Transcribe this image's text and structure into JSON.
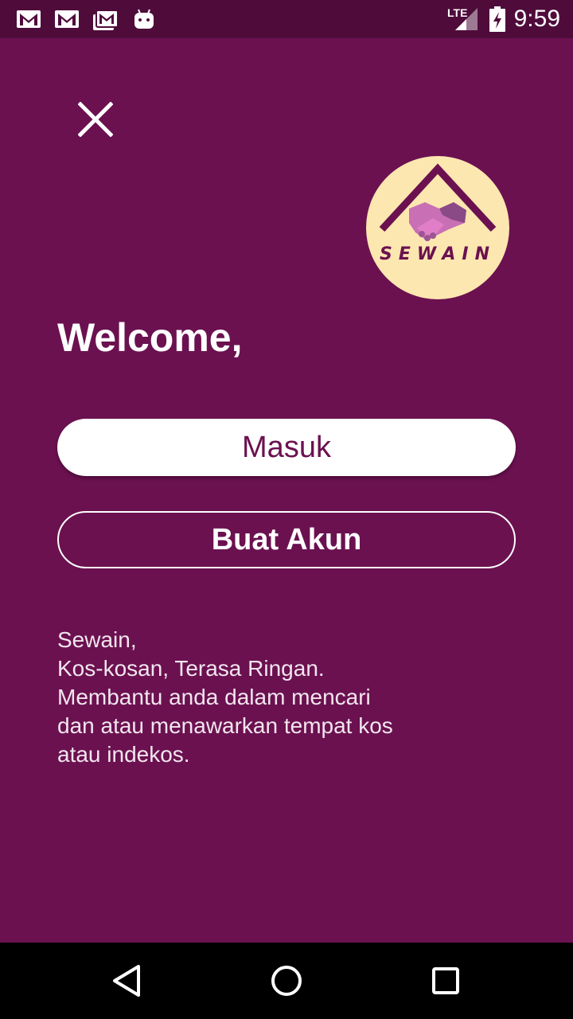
{
  "status_bar": {
    "time": "9:59",
    "network": "LTE",
    "icons": [
      "gmail-icon",
      "gmail-icon",
      "gmail-icon",
      "android-icon",
      "lte-signal-icon",
      "battery-charging-icon"
    ]
  },
  "colors": {
    "background": "#6b1150",
    "status_bar": "#4f0c3b",
    "logo_circle": "#fde7b0",
    "button_text": "#6b1150"
  },
  "logo": {
    "text": "SEWAIN",
    "icon": "handshake-house-logo"
  },
  "welcome_title": "Welcome,",
  "buttons": {
    "login": "Masuk",
    "register": "Buat Akun"
  },
  "description": {
    "lines": [
      "Sewain,",
      "Kos-kosan, Terasa Ringan.",
      "Membantu anda dalam mencari",
      "dan atau menawarkan tempat kos",
      "atau indekos."
    ]
  },
  "nav_bar": {
    "icons": [
      "back-icon",
      "home-icon",
      "recents-icon"
    ]
  }
}
